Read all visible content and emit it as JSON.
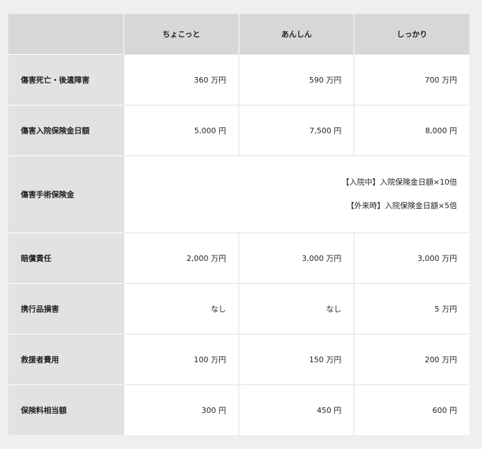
{
  "header": {
    "blank": "",
    "plans": [
      "ちょこっと",
      "あんしん",
      "しっかり"
    ]
  },
  "rows": [
    {
      "label": "傷害死亡・後遺障害",
      "values": [
        "360 万円",
        "590 万円",
        "700 万円"
      ]
    },
    {
      "label": "傷害入院保険金日額",
      "values": [
        "5,000 円",
        "7,500 円",
        "8,000 円"
      ]
    },
    {
      "label": "傷害手術保険金",
      "lines": [
        "【入院中】入院保険金日額×10倍",
        "【外来時】入院保険金日額×5倍"
      ]
    },
    {
      "label": "賠償責任",
      "values": [
        "2,000 万円",
        "3,000 万円",
        "3,000 万円"
      ]
    },
    {
      "label": "携行品損害",
      "values": [
        "なし",
        "なし",
        "5 万円"
      ]
    },
    {
      "label": "救援者費用",
      "values": [
        "100 万円",
        "150 万円",
        "200 万円"
      ]
    },
    {
      "label": "保険料相当額",
      "values": [
        "300 円",
        "450 円",
        "600 円"
      ]
    }
  ]
}
